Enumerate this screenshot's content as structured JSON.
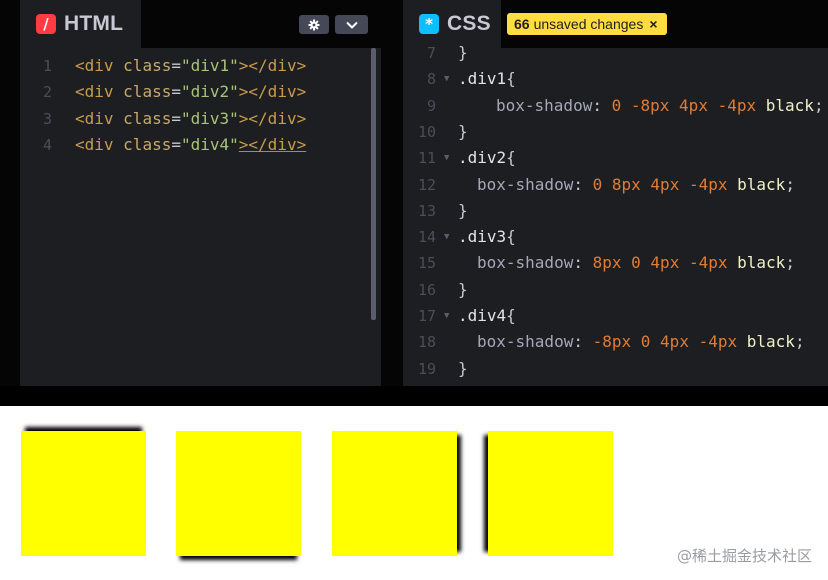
{
  "html_panel": {
    "title": "HTML",
    "icon": "/",
    "icon_color": "#ff3c41",
    "settings_icon": "gear-icon",
    "dropdown_icon": "chevron-down-icon",
    "lines": [
      {
        "n": "1",
        "tag_open": "<div ",
        "attr": "class",
        "eq": "=",
        "str": "\"div1\"",
        "tag_close": "></div>"
      },
      {
        "n": "2",
        "tag_open": "<div ",
        "attr": "class",
        "eq": "=",
        "str": "\"div2\"",
        "tag_close": "></div>"
      },
      {
        "n": "3",
        "tag_open": "<div ",
        "attr": "class",
        "eq": "=",
        "str": "\"div3\"",
        "tag_close": "></div>"
      },
      {
        "n": "4",
        "tag_open": "<div ",
        "attr": "class",
        "eq": "=",
        "str": "\"div4\"",
        "tag_close": "></div>"
      }
    ]
  },
  "css_panel": {
    "title": "CSS",
    "icon": "*",
    "icon_color": "#0ebeff",
    "badge": {
      "count": "66",
      "text": "unsaved changes",
      "close": "×",
      "color": "#ffdd40"
    },
    "lines": [
      {
        "n": "7",
        "text": "}"
      },
      {
        "n": "8",
        "selector": ".div1",
        "brace": "{"
      },
      {
        "n": "9",
        "prop": "box-shadow",
        "colon": ": ",
        "v1": "0",
        "v2": "-8px",
        "v3": "4px",
        "v4": "-4px",
        "kw": "black",
        "semi": ";"
      },
      {
        "n": "10",
        "text": "}"
      },
      {
        "n": "11",
        "selector": ".div2",
        "brace": "{"
      },
      {
        "n": "12",
        "prop": "box-shadow",
        "colon": ": ",
        "v1": "0",
        "v2": "8px",
        "v3": "4px",
        "v4": "-4px",
        "kw": "black",
        "semi": ";"
      },
      {
        "n": "13",
        "text": "}"
      },
      {
        "n": "14",
        "selector": ".div3",
        "brace": "{"
      },
      {
        "n": "15",
        "prop": "box-shadow",
        "colon": ": ",
        "v1": "8px",
        "v2": "0",
        "v3": "4px",
        "v4": "-4px",
        "kw": "black",
        "semi": ";"
      },
      {
        "n": "16",
        "text": "}"
      },
      {
        "n": "17",
        "selector": ".div4",
        "brace": "{"
      },
      {
        "n": "18",
        "prop": "box-shadow",
        "colon": ": ",
        "v1": "-8px",
        "v2": "0",
        "v3": "4px",
        "v4": "-4px",
        "kw": "black",
        "semi": ";"
      },
      {
        "n": "19",
        "text": "}"
      }
    ]
  },
  "preview": {
    "box_color": "#ffff00",
    "boxes": [
      "div1",
      "div2",
      "div3",
      "div4"
    ],
    "watermark": "@稀土掘金技术社区"
  }
}
